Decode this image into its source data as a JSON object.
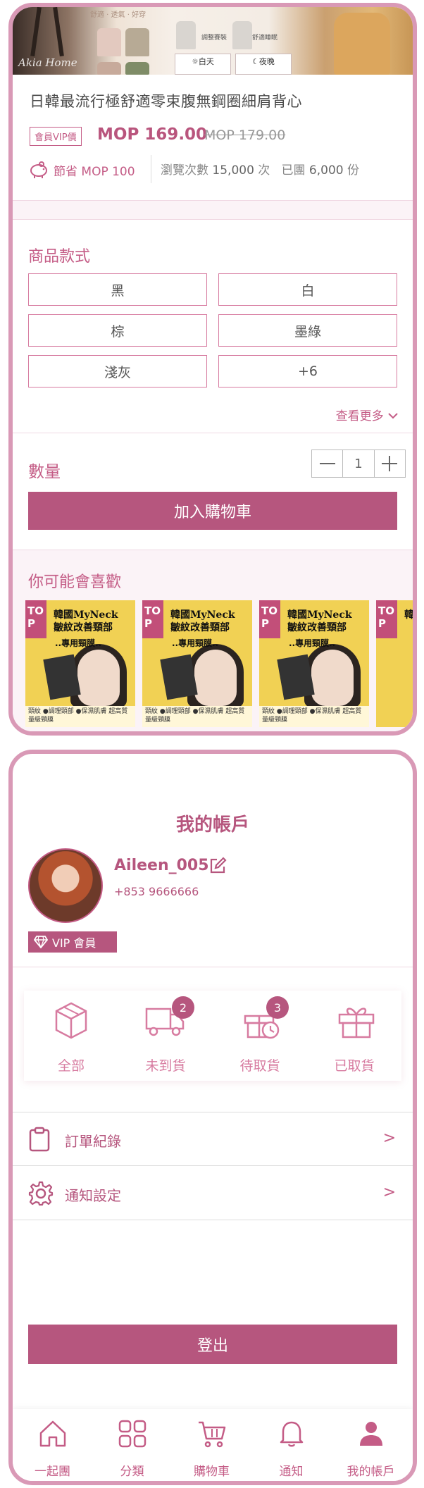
{
  "product": {
    "banner_brand": "Akia Home",
    "banner_tagline": "舒適 · 透氣 · 好穿",
    "banner_box_day": "☼白天",
    "banner_box_night": "☾夜晚",
    "banner_label_1": "調整賽裝",
    "banner_label_2": "舒適睡眠",
    "title": "日韓最流行極舒適零束腹無鋼圈細肩背心",
    "vip_tag": "會員VIP價",
    "price": "MOP 169.00",
    "old_price": "MOP 179.00",
    "save_text": "節省 MOP 100",
    "views_prefix": "瀏覽次數",
    "views_value": "15,000",
    "views_suffix": "次",
    "sold_prefix": "已團",
    "sold_value": "6,000",
    "sold_suffix": "份"
  },
  "options": {
    "title": "商品款式",
    "items": [
      "黑",
      "白",
      "棕",
      "墨綠",
      "淺灰",
      "+6"
    ],
    "see_more": "查看更多"
  },
  "quantity": {
    "label": "數量",
    "minus": "—",
    "value": "1",
    "plus": "+"
  },
  "add_to_cart": "加入購物車",
  "recommend": {
    "title": "你可能會喜歡",
    "cards": [
      {
        "tag": "TO P",
        "headline": "韓國MyNeck 皺紋改善頸部",
        "sub": "..專用頸膜..",
        "footer": "頸紋 ●調理頸部 ●保濕肌膚 超高質量級頸膜"
      },
      {
        "tag": "TO P",
        "headline": "韓國MyNeck 皺紋改善頸部",
        "sub": "..專用頸膜..",
        "footer": "頸紋 ●調理頸部 ●保濕肌膚 超高質量級頸膜"
      },
      {
        "tag": "TO P",
        "headline": "韓國MyNeck 皺紋改善頸部",
        "sub": "..專用頸膜..",
        "footer": "頸紋 ●調理頸部 ●保濕肌膚 超高質量級頸膜"
      },
      {
        "tag": "TO P",
        "headline": "韓國MyNeck",
        "sub": "",
        "footer": ""
      }
    ]
  },
  "account": {
    "title": "我的帳戶",
    "username": "Aileen_005",
    "phone": "+853 9666666",
    "vip_badge": "VIP 會員",
    "orders": [
      {
        "label": "全部",
        "icon": "box-icon",
        "badge": ""
      },
      {
        "label": "未到貨",
        "icon": "truck-icon",
        "badge": "2"
      },
      {
        "label": "待取貨",
        "icon": "gift-clock-icon",
        "badge": "3"
      },
      {
        "label": "已取貨",
        "icon": "gift-icon",
        "badge": ""
      }
    ],
    "menu": [
      {
        "label": "訂單紀錄",
        "icon": "clipboard-icon",
        "chevron": ">"
      },
      {
        "label": "通知設定",
        "icon": "gear-icon",
        "chevron": ">"
      }
    ],
    "logout": "登出"
  },
  "tabbar": {
    "items": [
      {
        "label": "一起團",
        "icon": "home-icon"
      },
      {
        "label": "分類",
        "icon": "grid-icon"
      },
      {
        "label": "購物車",
        "icon": "cart-icon"
      },
      {
        "label": "通知",
        "icon": "bell-icon"
      },
      {
        "label": "我的帳戶",
        "icon": "user-icon"
      }
    ]
  },
  "colors": {
    "accent": "#b6567e",
    "accent_light": "#d77ba0",
    "frame": "#d999b6"
  }
}
